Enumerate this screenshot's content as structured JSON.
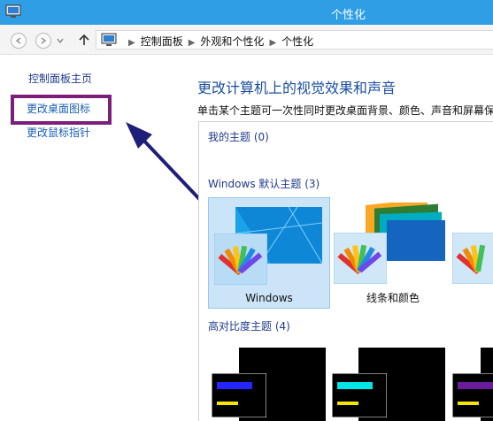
{
  "window": {
    "title": "个性化"
  },
  "breadcrumb": {
    "items": [
      "控制面板",
      "外观和个性化",
      "个性化"
    ]
  },
  "sidebar": {
    "home": "控制面板主页",
    "items": [
      "更改桌面图标",
      "更改鼠标指针"
    ]
  },
  "main": {
    "heading": "更改计算机上的视觉效果和声音",
    "description": "单击某个主题可一次性同时更改桌面背景、颜色、声音和屏幕保护",
    "groups": {
      "my_themes": "我的主题 (0)",
      "default_themes": "Windows 默认主题 (3)",
      "high_contrast": "高对比度主题 (4)"
    },
    "themes": [
      "Windows",
      "线条和颜色"
    ]
  },
  "colors": {
    "titlebar": "#2f9ee5",
    "highlight_box": "#7b1f7b",
    "arrow": "#1f1f7a",
    "link": "#1a5fb4"
  }
}
